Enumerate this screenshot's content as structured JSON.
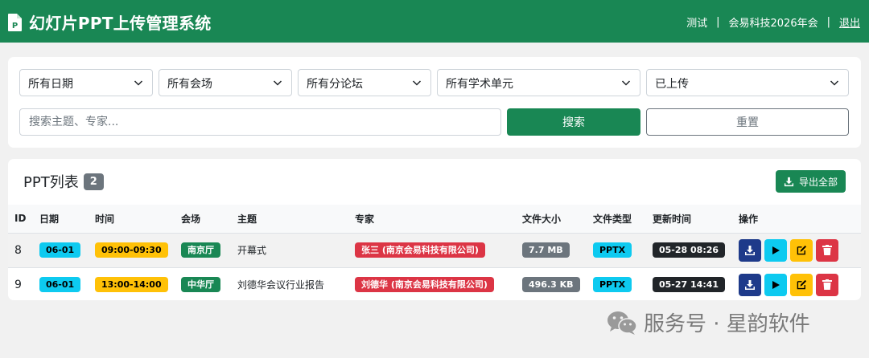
{
  "header": {
    "title": "幻灯片PPT上传管理系统",
    "user": "测试",
    "separator": "|",
    "event": "会易科技2026年会",
    "logout": "退出"
  },
  "filters": {
    "date": "所有日期",
    "venue": "所有会场",
    "forum": "所有分论坛",
    "unit": "所有学术单元",
    "status": "已上传",
    "search_placeholder": "搜索主题、专家...",
    "search_button": "搜索",
    "reset_button": "重置"
  },
  "list": {
    "title": "PPT列表",
    "count": "2",
    "export_button": "导出全部",
    "columns": [
      "ID",
      "日期",
      "时间",
      "会场",
      "主题",
      "专家",
      "文件大小",
      "文件类型",
      "更新时间",
      "操作"
    ],
    "rows": [
      {
        "id": "8",
        "date": "06-01",
        "time": "09:00-09:30",
        "venue": "南京厅",
        "topic": "开幕式",
        "expert": "张三 (南京会易科技有限公司)",
        "size": "7.7 MB",
        "type": "PPTX",
        "updated": "05-28 08:26"
      },
      {
        "id": "9",
        "date": "06-01",
        "time": "13:00-14:00",
        "venue": "中华厅",
        "topic": "刘德华会议行业报告",
        "expert": "刘德华 (南京会易科技有限公司)",
        "size": "496.3 KB",
        "type": "PPTX",
        "updated": "05-27 14:41"
      }
    ]
  },
  "watermark": {
    "text": "服务号 · 星韵软件"
  },
  "colors": {
    "primary": "#198754",
    "download": "#1e3a8a",
    "play": "#0dcaf0",
    "edit": "#ffc107",
    "delete": "#dc3545"
  }
}
